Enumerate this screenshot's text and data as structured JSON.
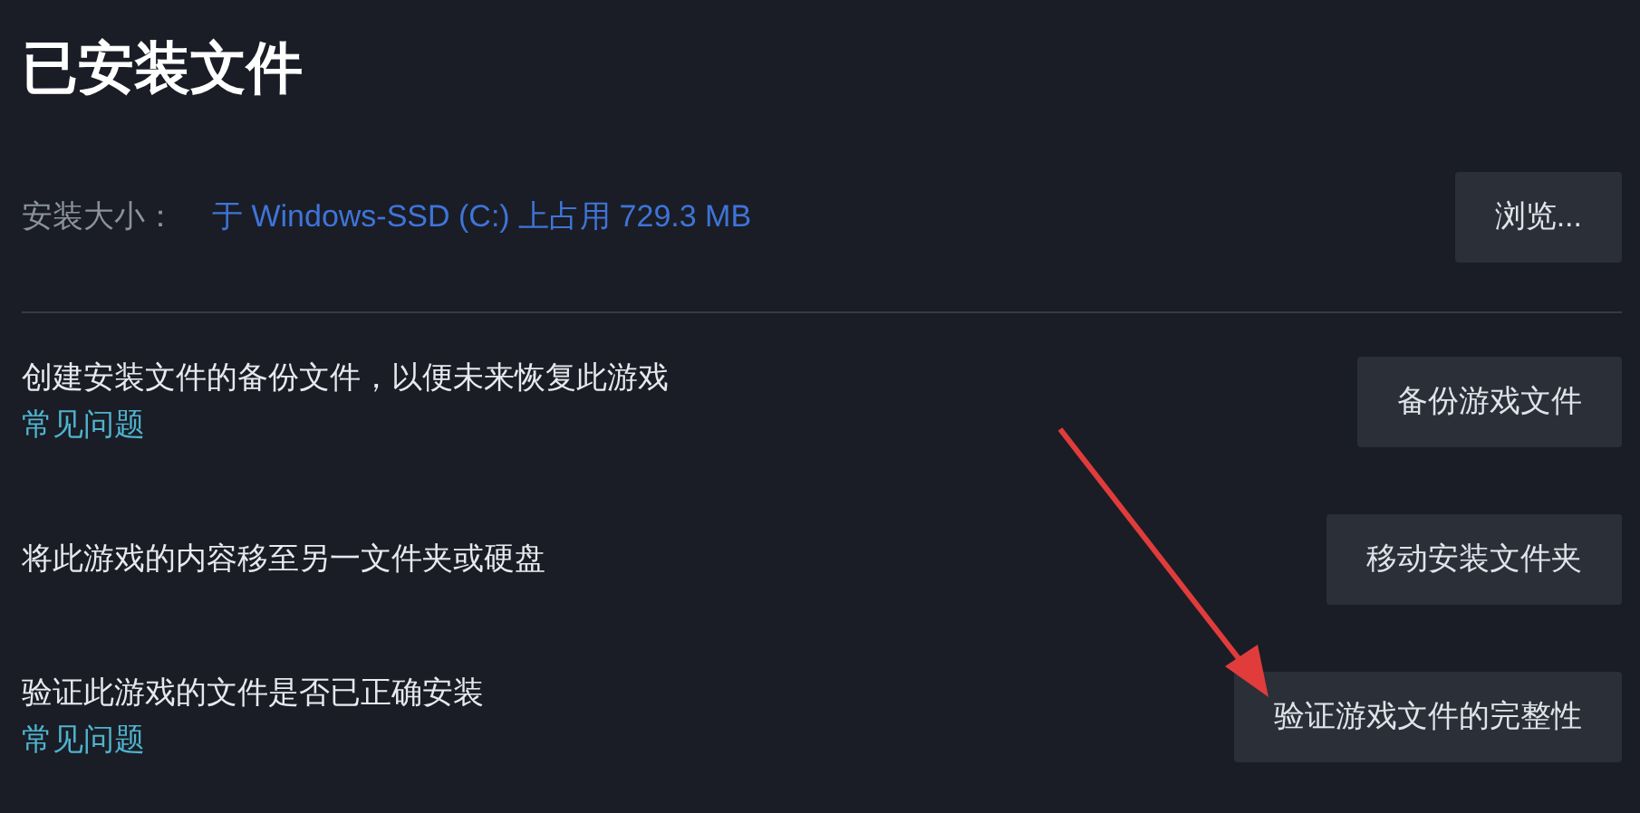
{
  "title": "已安装文件",
  "install_size": {
    "label": "安装大小：",
    "value": "于 Windows-SSD (C:) 上占用 729.3 MB",
    "button": "浏览..."
  },
  "actions": [
    {
      "description": "创建安装文件的备份文件，以便未来恢复此游戏",
      "link": "常见问题",
      "button": "备份游戏文件"
    },
    {
      "description": "将此游戏的内容移至另一文件夹或硬盘",
      "button": "移动安装文件夹"
    },
    {
      "description": "验证此游戏的文件是否已正确安装",
      "link": "常见问题",
      "button": "验证游戏文件的完整性"
    }
  ]
}
